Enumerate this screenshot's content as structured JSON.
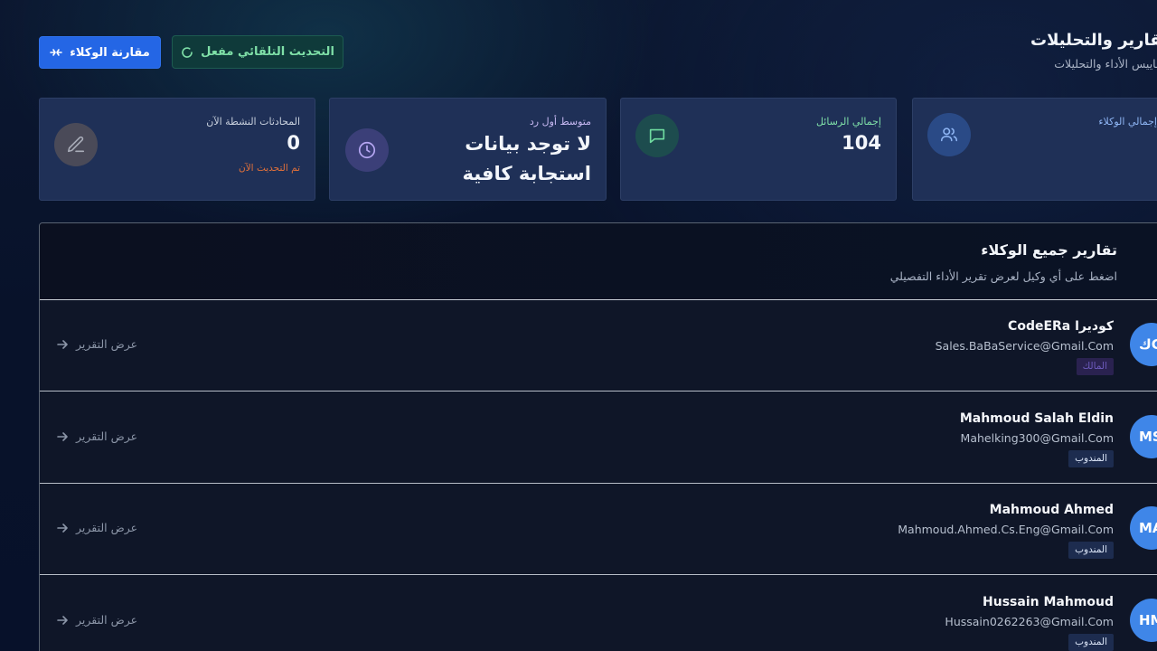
{
  "header": {
    "title": "تقارير والتحليلات",
    "subtitle": "مقاييس الأداء والتحليلات"
  },
  "buttons": {
    "compare_label": "مقارنة الوكلاء",
    "auto_refresh_label": "التحديث التلقائي مفعل"
  },
  "stats": [
    {
      "label": "المحادثات النشطة الآن",
      "value": "0",
      "note": "تم التحديث الآن",
      "icon": "pencil-icon"
    },
    {
      "label": "متوسط أول رد",
      "value_line1": "لا توجد بيانات",
      "value_line2": "استجابة كافية",
      "icon": "clock-icon"
    },
    {
      "label": "إجمالي الرسائل",
      "value": "104",
      "icon": "message-icon"
    },
    {
      "label": "إجمالي الوكلاء",
      "value": "",
      "icon": "users-icon"
    }
  ],
  "reports": {
    "title": "تقارير جميع الوكلاء",
    "subtitle": "اضغط على أي وكيل لعرض تقرير الأداء التفصيلي",
    "view_label": "عرض التقرير",
    "agents": [
      {
        "initials": "كC",
        "name": "CodeERa كوديرا",
        "email": "Sales.BaBaService@Gmail.Com",
        "role": "المالك"
      },
      {
        "initials": "MS",
        "name": "Mahmoud Salah Eldin",
        "email": "Mahelking300@Gmail.Com",
        "role": "المندوب"
      },
      {
        "initials": "MA",
        "name": "Mahmoud Ahmed",
        "email": "Mahmoud.Ahmed.Cs.Eng@Gmail.Com",
        "role": "المندوب"
      },
      {
        "initials": "HM",
        "name": "Hussain Mahmoud",
        "email": "Hussain0262263@Gmail.Com",
        "role": "المندوب"
      }
    ]
  },
  "colors": {
    "primary": "#2466e5",
    "success": "#7fe0a8",
    "card": "#1f3057",
    "avatar": "#3f86e8",
    "warning": "#e0703a"
  }
}
